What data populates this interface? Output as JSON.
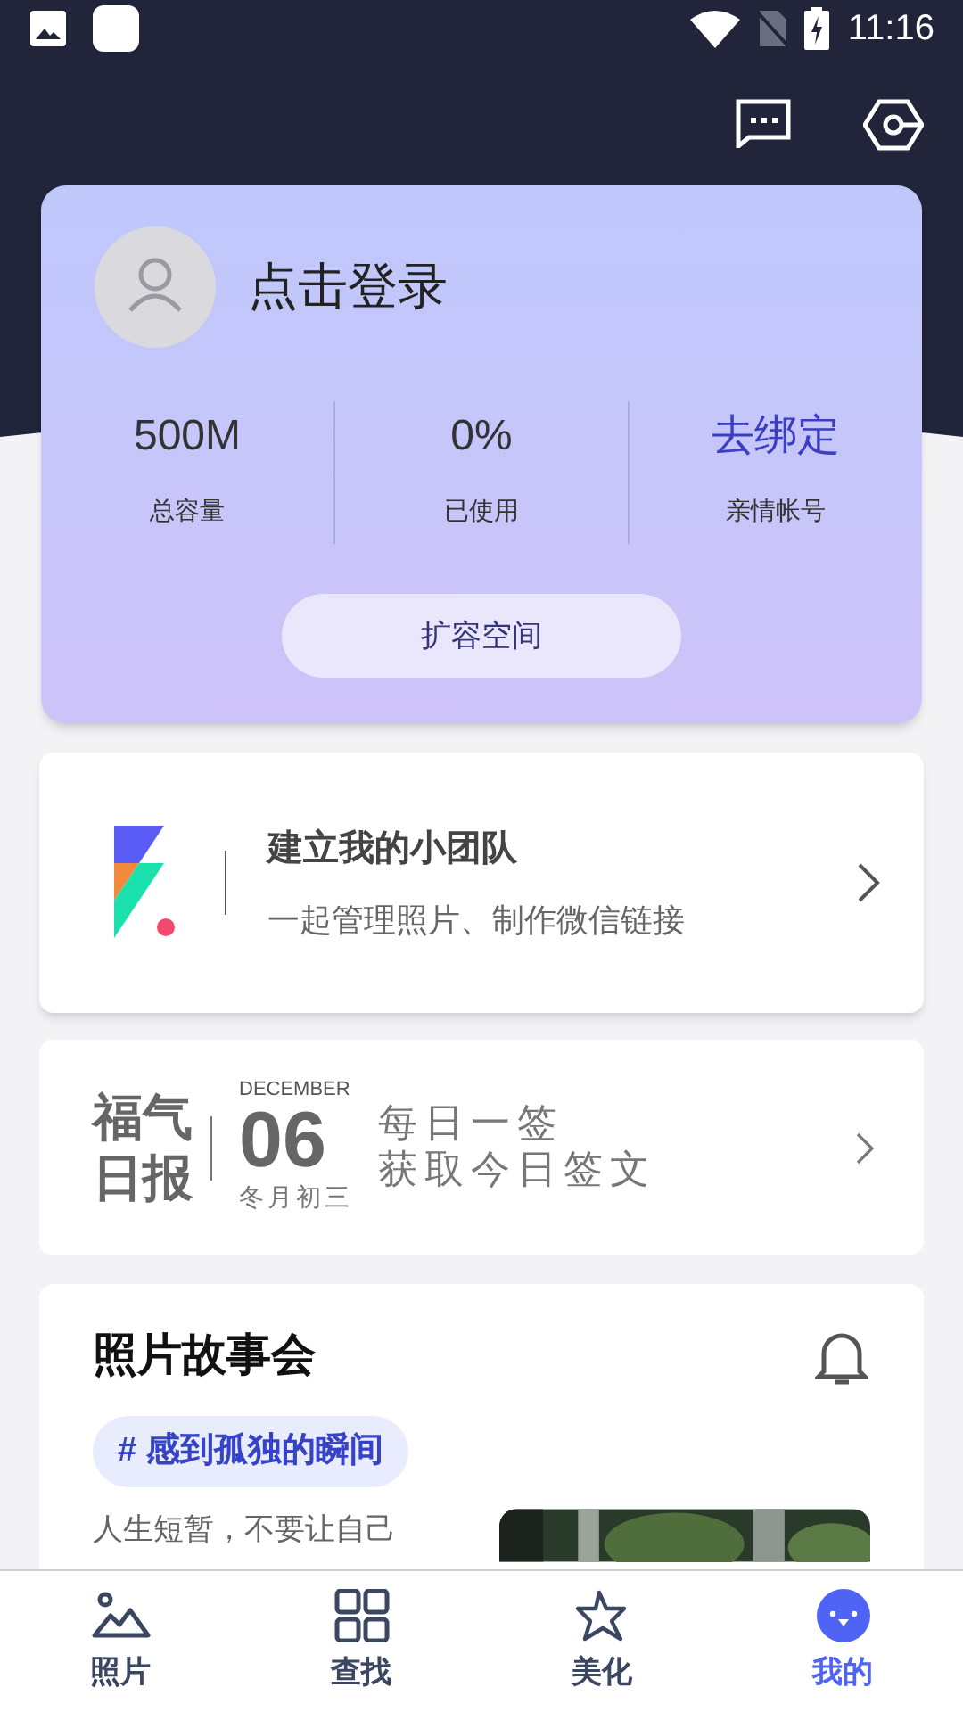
{
  "status_bar": {
    "time": "11:16"
  },
  "account": {
    "login_label": "点击登录",
    "stats": [
      {
        "value": "500M",
        "label": "总容量",
        "kind": "plain"
      },
      {
        "value": "0%",
        "label": "已使用",
        "kind": "plain"
      },
      {
        "value": "去绑定",
        "label": "亲情帐号",
        "kind": "link"
      }
    ],
    "expand_button": "扩容空间"
  },
  "team": {
    "title": "建立我的小团队",
    "subtitle": "一起管理照片、制作微信链接"
  },
  "daily": {
    "brand_line_1": "福气",
    "brand_line_2": "日报",
    "month": "DECEMBER",
    "day": "06",
    "lunar_date": "冬月初三",
    "line_1": "每日一签",
    "line_2": "获取今日签文"
  },
  "stories": {
    "title": "照片故事会",
    "topic": "# 感到孤独的瞬间",
    "excerpt": "人生短暂，不要让自己"
  },
  "bottom_nav": [
    {
      "label": "照片",
      "selected": false
    },
    {
      "label": "查找",
      "selected": false
    },
    {
      "label": "美化",
      "selected": false
    },
    {
      "label": "我的",
      "selected": true
    }
  ]
}
